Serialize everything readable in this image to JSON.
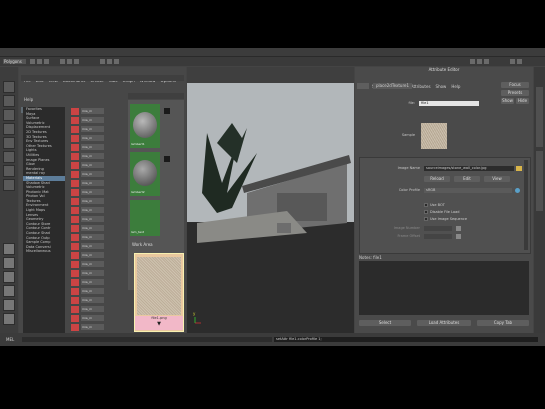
{
  "menubar": {
    "items": [
      "File",
      "Edit",
      "Modify",
      "Create",
      "Display",
      "Window",
      "Assets",
      "Select",
      "Mesh",
      "Edit Mesh",
      "Proxy",
      "Normals",
      "Color",
      "Create UVs",
      "Edit UVs",
      "Help"
    ]
  },
  "shelf": {
    "mode_label": "Polygons"
  },
  "hypershade": {
    "menu": [
      "File",
      "Edit",
      "View",
      "Bookmarks",
      "Create",
      "Tabs",
      "Graph",
      "Window",
      "Options",
      "Help"
    ],
    "tabs": [
      "Create",
      "Bins"
    ],
    "tree": [
      "Favorites",
      "Maya",
      "Surface",
      "Volumetric",
      "Displacement",
      "2D Textures",
      "3D Textures",
      "Env Textures",
      "Other Textures",
      "Lights",
      "Utilities",
      "Image Planes",
      "Glow",
      "Rendering",
      "mental ray",
      "Materials",
      "Shadow Shad",
      "Volumetric",
      "Photonic Mat",
      "Photon Vol",
      "Textures",
      "Environment",
      "Light Maps",
      "Lenses",
      "Geometry",
      "Contour Store",
      "Contour Contr",
      "Contour Shad",
      "Contour Outp",
      "Sample Comp",
      "Data Conversi",
      "Miscellaneous"
    ],
    "selected_index": 15,
    "nodes": [
      "mia_m",
      "mia_m",
      "mia_m",
      "mia_m",
      "mia_m",
      "mia_m",
      "mia_m",
      "mia_m",
      "mia_m",
      "mia_m",
      "mia_m",
      "mia_m",
      "mia_m",
      "mia_m",
      "mia_m",
      "mia_m",
      "mia_m",
      "mia_m",
      "mia_m",
      "mia_m",
      "mia_m",
      "mia_m",
      "mia_m",
      "mia_m",
      "mia_m",
      "mia_m"
    ],
    "swatches": [
      {
        "label": "lambert1"
      },
      {
        "label": "lambert2"
      },
      {
        "label": "lam_text"
      }
    ],
    "work_label": "Work Area",
    "texture_label": "file1.png"
  },
  "viewport": {
    "menu": [
      "View",
      "Shading",
      "Lighting",
      "Show",
      "Renderer",
      "Panels"
    ]
  },
  "attr_editor": {
    "title": "Attribute Editor",
    "menu": [
      "List",
      "Selected",
      "Focus",
      "Attributes",
      "Show",
      "Help"
    ],
    "node_tab": "place2dTexture1",
    "file_label": "file:",
    "file_value": "file1",
    "sample_label": "Sample",
    "focus_btn": "Focus",
    "presets_btn": "Presets",
    "show_btn": "Show",
    "hide_btn": "Hide",
    "image_name_label": "Image Name",
    "image_name_value": "sourceimages/stone_wall_color.jpg",
    "reload_btn": "Reload",
    "edit_btn": "Edit",
    "view_btn": "View",
    "color_profile_label": "Color Profile",
    "color_profile_value": "sRGB",
    "checks": [
      "Use BOT",
      "Disable File Load",
      "Use Image Sequence"
    ],
    "image_number_label": "Image Number",
    "frame_offset_label": "Frame Offset",
    "notes_label": "Notes: file1",
    "select_btn": "Select",
    "load_attr_btn": "Load Attributes",
    "copy_tab_btn": "Copy Tab"
  },
  "command": {
    "text": "setAttr file1.colorProfile 1;"
  }
}
